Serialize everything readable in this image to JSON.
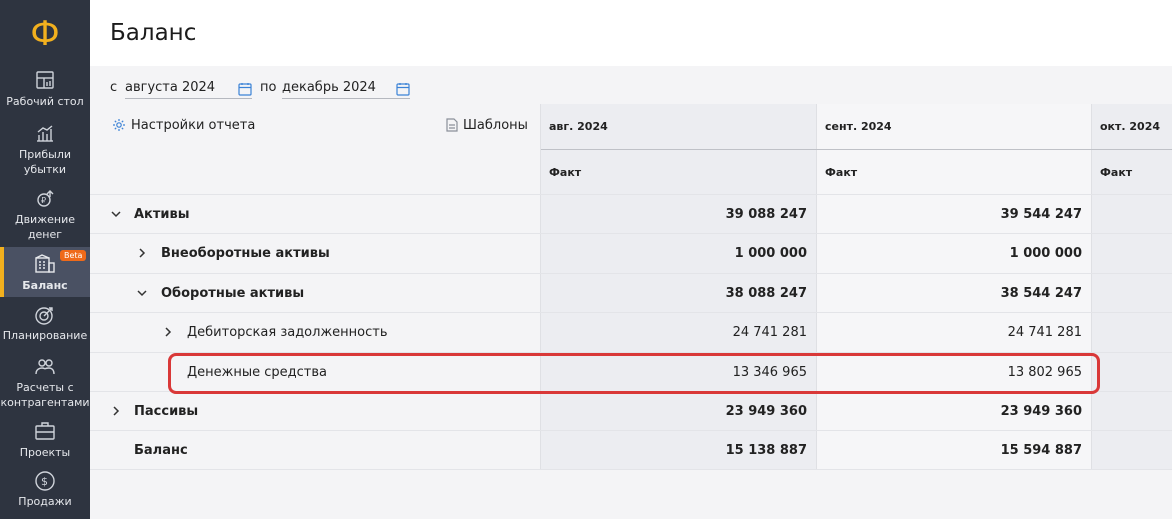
{
  "sidebar": {
    "logo": "Ф",
    "items": [
      {
        "label": "Рабочий стол",
        "icon": "dashboard-icon"
      },
      {
        "label": "Прибыли\nубытки",
        "icon": "chart-bars-icon"
      },
      {
        "label": "Движение\nденег",
        "icon": "money-flow-icon"
      },
      {
        "label": "Баланс",
        "icon": "balance-icon",
        "active": true,
        "badge": "Beta"
      },
      {
        "label": "Планирование",
        "icon": "target-icon"
      },
      {
        "label": "Расчеты с\nконтрагентами",
        "icon": "people-icon"
      },
      {
        "label": "Проекты",
        "icon": "briefcase-icon"
      },
      {
        "label": "Продажи",
        "icon": "dollar-circle-icon"
      }
    ]
  },
  "header": {
    "title": "Баланс"
  },
  "filters": {
    "from_label": "с",
    "from_value": "августа 2024",
    "to_label": "по",
    "to_value": "декабрь 2024"
  },
  "toolbar": {
    "settings_label": "Настройки отчета",
    "templates_label": "Шаблоны"
  },
  "columns": [
    {
      "period": "авг. 2024",
      "kind": "Факт"
    },
    {
      "period": "сент. 2024",
      "kind": "Факт"
    },
    {
      "period": "окт. 2024",
      "kind": "Факт"
    }
  ],
  "rows": [
    {
      "label": "Активы",
      "level": 0,
      "chevron": "down",
      "bold": true,
      "values": [
        "39 088 247",
        "39 544 247"
      ]
    },
    {
      "label": "Внеоборотные активы",
      "level": 1,
      "chevron": "right",
      "bold": true,
      "values": [
        "1 000 000",
        "1 000 000"
      ]
    },
    {
      "label": "Оборотные активы",
      "level": 1,
      "chevron": "down",
      "bold": true,
      "values": [
        "38 088 247",
        "38 544 247"
      ]
    },
    {
      "label": "Дебиторская задолженность",
      "level": 2,
      "chevron": "right",
      "bold": false,
      "values": [
        "24 741 281",
        "24 741 281"
      ]
    },
    {
      "label": "Денежные средства",
      "level": 2,
      "chevron": "",
      "bold": false,
      "values": [
        "13 346 965",
        "13 802 965"
      ]
    },
    {
      "label": "Пассивы",
      "level": 0,
      "chevron": "right",
      "bold": true,
      "values": [
        "23 949 360",
        "23 949 360"
      ]
    },
    {
      "label": "Баланс",
      "level": 0,
      "chevron": "",
      "bold": true,
      "values": [
        "15 138 887",
        "15 594 887"
      ]
    }
  ],
  "colors": {
    "accent": "#f2b01e",
    "sidebar": "#2e3440",
    "highlight": "#d93838",
    "beta": "#ef6a1a"
  }
}
